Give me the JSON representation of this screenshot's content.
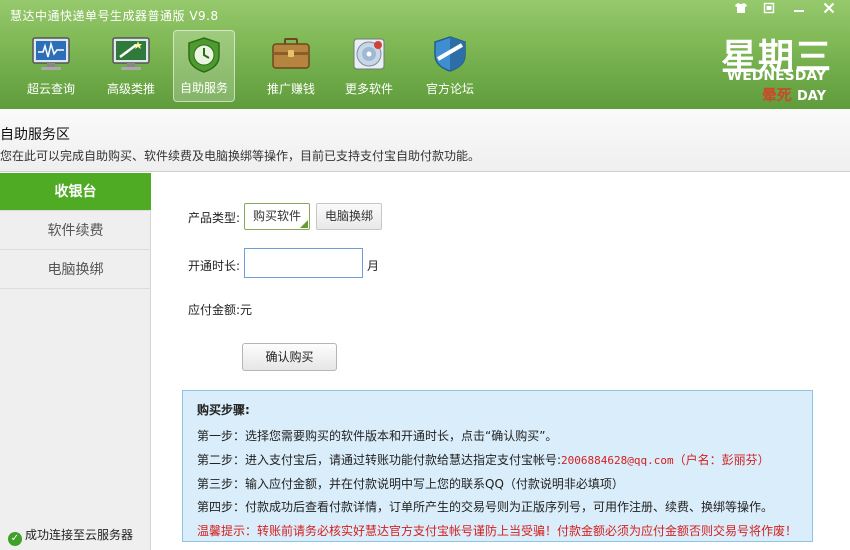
{
  "window": {
    "title": "慧达中通快递单号生成器普通版 V9.8",
    "controls": [
      "shirt-icon",
      "restore-icon",
      "minimize-icon",
      "close-icon"
    ]
  },
  "nav": {
    "items": [
      {
        "label": "超云查询",
        "icon": "monitor-icon"
      },
      {
        "label": "高级类推",
        "icon": "magic-screen-icon"
      },
      {
        "label": "自助服务",
        "icon": "clock-shield-icon",
        "active": true
      },
      {
        "label": "推广赚钱",
        "icon": "briefcase-icon"
      },
      {
        "label": "更多软件",
        "icon": "disc-icon"
      },
      {
        "label": "官方论坛",
        "icon": "shield-icon"
      }
    ]
  },
  "date": {
    "cn": "星期三",
    "en": "WEDNESDAY",
    "extra_cn": "晕死",
    "extra_en": "DAY"
  },
  "section": {
    "title": "自助服务区",
    "subtitle": "您在此可以完成自助购买、软件续费及电脑换绑等操作，目前已支持支付宝自助付款功能。"
  },
  "sidebar": {
    "items": [
      {
        "label": "收银台",
        "active": true
      },
      {
        "label": "软件续费"
      },
      {
        "label": "电脑换绑"
      }
    ],
    "status": "成功连接至云服务器"
  },
  "form": {
    "product_type_label": "产品类型:",
    "product_options": [
      "购买软件",
      "电脑换绑"
    ],
    "duration_label": "开通时长:",
    "duration_value": "",
    "duration_unit": "月",
    "amount_label": "应付金额:",
    "amount_unit": "元",
    "confirm_label": "确认购买"
  },
  "info": {
    "title": "购买步骤:",
    "step1": "第一步：选择您需要购买的软件版本和开通时长，点击“确认购买”。",
    "step2_prefix": "第二步：进入支付宝后，请通过转账功能付款给慧达指定支付宝帐号:",
    "step2_account": "2006884628@qq.com",
    "step2_owner": "（户名：彭丽芬）",
    "step3": "第三步：输入应付金额，并在付款说明中写上您的联系QQ（付款说明非必填项）",
    "step4": "第四步：付款成功后查看付款详情，订单所产生的交易号则为正版序列号，可用作注册、续费、换绑等操作。",
    "tip": "温馨提示：转账前请务必核实好慧达官方支付宝帐号谨防上当受骗！付款金额必须为应付金额否则交易号将作废！"
  },
  "colors": {
    "banner": "#7fb855",
    "sidebar_active": "#4faa24",
    "info_bg": "#d9edfa",
    "warning": "#d42020"
  }
}
